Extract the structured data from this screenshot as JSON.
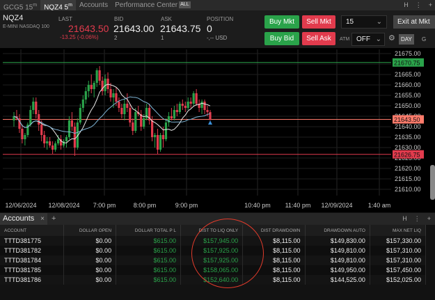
{
  "tabs": [
    {
      "label": "GCG5 15",
      "sup": "m"
    },
    {
      "label": "NQZ4 5",
      "sup": "m"
    },
    {
      "label": "Accounts",
      "sup": ""
    },
    {
      "label": "Performance Center",
      "sup": ""
    }
  ],
  "tabs_badge": "ALL",
  "quote": {
    "symbol": "NQZ4",
    "symbol_desc": "E-MINI NASDAQ 100",
    "last_label": "LAST",
    "last": "21643.50",
    "change": "-13.25 (-0.06%)",
    "bid_label": "BID",
    "bid": "21643.00",
    "bid_size": "2",
    "ask_label": "ASK",
    "ask": "21643.75",
    "ask_size": "1",
    "position_label": "POSITION",
    "position": "0",
    "position_sub": "-,-- USD"
  },
  "controls": {
    "buy_mkt": "Buy Mkt",
    "sell_mkt": "Sell Mkt",
    "buy_bid": "Buy Bid",
    "sell_ask": "Sell Ask",
    "qty": "15",
    "exit": "Exit at Mkt",
    "atm_label": "ATM",
    "atm_value": "OFF",
    "day": "DAY",
    "tif2": "G"
  },
  "chart_data": {
    "type": "candlestick",
    "y_ticks": [
      "21675.00",
      "21670.00",
      "21665.00",
      "21660.00",
      "21655.00",
      "21650.00",
      "21645.00",
      "21640.00",
      "21635.00",
      "21630.00",
      "21625.00",
      "21620.00",
      "21615.00",
      "21610.00"
    ],
    "ylim": [
      21607,
      21677
    ],
    "x_ticks": [
      "12/06/2024",
      "12/08/2024",
      "7:00 pm",
      "8:00 pm",
      "9:00 pm",
      "10:40 pm",
      "11:40 pm",
      "12/09/2024",
      "1:40 am"
    ],
    "price_labels": [
      {
        "value": 21670.75,
        "text": "21670.75",
        "color": "#2aa34a"
      },
      {
        "value": 21643.5,
        "text": "21643.50",
        "color": "#ff7b6b"
      },
      {
        "value": 21626.75,
        "text": "21626.75",
        "color": "#e23b4d"
      }
    ],
    "candles": [
      [
        21643,
        21647,
        21640,
        21645
      ],
      [
        21645,
        21648,
        21643,
        21644
      ],
      [
        21644,
        21646,
        21637,
        21639
      ],
      [
        21639,
        21641,
        21632,
        21634
      ],
      [
        21634,
        21637,
        21631,
        21636
      ],
      [
        21636,
        21642,
        21635,
        21641
      ],
      [
        21641,
        21650,
        21640,
        21648
      ],
      [
        21648,
        21654,
        21646,
        21652
      ],
      [
        21652,
        21654,
        21644,
        21646
      ],
      [
        21646,
        21648,
        21638,
        21641
      ],
      [
        21641,
        21643,
        21633,
        21636
      ],
      [
        21636,
        21638,
        21630,
        21632
      ],
      [
        21632,
        21635,
        21629,
        21633
      ],
      [
        21633,
        21635,
        21630,
        21631
      ],
      [
        21631,
        21633,
        21627,
        21629
      ],
      [
        21629,
        21633,
        21628,
        21632
      ],
      [
        21632,
        21636,
        21631,
        21634
      ],
      [
        21634,
        21636,
        21629,
        21631
      ],
      [
        21631,
        21634,
        21630,
        21633
      ],
      [
        21633,
        21636,
        21630,
        21635
      ],
      [
        21635,
        21645,
        21634,
        21643
      ],
      [
        21643,
        21647,
        21638,
        21640
      ],
      [
        21640,
        21642,
        21626,
        21630
      ],
      [
        21630,
        21644,
        21629,
        21642
      ],
      [
        21642,
        21651,
        21641,
        21649
      ],
      [
        21649,
        21655,
        21647,
        21653
      ],
      [
        21653,
        21659,
        21651,
        21657
      ],
      [
        21657,
        21662,
        21654,
        21660
      ],
      [
        21660,
        21665,
        21656,
        21658
      ],
      [
        21658,
        21662,
        21654,
        21661
      ],
      [
        21661,
        21668,
        21659,
        21667
      ],
      [
        21667,
        21669,
        21660,
        21662
      ],
      [
        21662,
        21664,
        21655,
        21657
      ],
      [
        21657,
        21665,
        21655,
        21663
      ],
      [
        21663,
        21666,
        21656,
        21658
      ],
      [
        21658,
        21661,
        21652,
        21654
      ],
      [
        21654,
        21658,
        21649,
        21656
      ],
      [
        21656,
        21659,
        21650,
        21652
      ],
      [
        21652,
        21654,
        21647,
        21649
      ],
      [
        21649,
        21651,
        21644,
        21646
      ],
      [
        21646,
        21653,
        21643,
        21651
      ],
      [
        21651,
        21656,
        21647,
        21649
      ],
      [
        21649,
        21651,
        21640,
        21642
      ],
      [
        21642,
        21644,
        21636,
        21638
      ],
      [
        21638,
        21649,
        21637,
        21647
      ],
      [
        21647,
        21650,
        21645,
        21646
      ],
      [
        21646,
        21648,
        21638,
        21640
      ],
      [
        21640,
        21646,
        21639,
        21644
      ],
      [
        21644,
        21651,
        21643,
        21649
      ],
      [
        21649,
        21651,
        21641,
        21643
      ],
      [
        21643,
        21645,
        21633,
        21635
      ],
      [
        21635,
        21637,
        21630,
        21636
      ],
      [
        21636,
        21639,
        21627,
        21629
      ],
      [
        21629,
        21637,
        21628,
        21636
      ],
      [
        21636,
        21640,
        21630,
        21634
      ],
      [
        21634,
        21644,
        21633,
        21642
      ],
      [
        21642,
        21647,
        21640,
        21645
      ],
      [
        21645,
        21649,
        21643,
        21644
      ],
      [
        21644,
        21650,
        21643,
        21648
      ],
      [
        21648,
        21651,
        21645,
        21647
      ],
      [
        21647,
        21652,
        21646,
        21651
      ],
      [
        21651,
        21653,
        21648,
        21650
      ],
      [
        21650,
        21652,
        21647,
        21649
      ],
      [
        21649,
        21654,
        21648,
        21652
      ],
      [
        21652,
        21654,
        21649,
        21651
      ],
      [
        21651,
        21657,
        21650,
        21656
      ],
      [
        21656,
        21658,
        21650,
        21651
      ],
      [
        21651,
        21653,
        21647,
        21649
      ],
      [
        21649,
        21653,
        21646,
        21652
      ],
      [
        21652,
        21653,
        21646,
        21648
      ],
      [
        21648,
        21650,
        21645,
        21647
      ],
      [
        21647,
        21648,
        21643,
        21643.5
      ]
    ]
  },
  "accounts": {
    "tab": "Accounts",
    "columns": [
      "ACCOUNT",
      "DOLLAR OPEN",
      "DOLLAR TOTAL P L",
      "DIST TO LIQ ONLY",
      "DIST DRAWDOWN",
      "DRAWDOWN AUTO",
      "MAX NET LIQ"
    ],
    "rows": [
      [
        "TTTD381775",
        "$0.00",
        "$615.00",
        "$157,945.00",
        "$8,115.00",
        "$149,830.00",
        "$157,330.00"
      ],
      [
        "TTTD381782",
        "$0.00",
        "$615.00",
        "$157,925.00",
        "$8,115.00",
        "$149,810.00",
        "$157,310.00"
      ],
      [
        "TTTD381784",
        "$0.00",
        "$615.00",
        "$157,925.00",
        "$8,115.00",
        "$149,810.00",
        "$157,310.00"
      ],
      [
        "TTTD381785",
        "$0.00",
        "$615.00",
        "$158,065.00",
        "$8,115.00",
        "$149,950.00",
        "$157,450.00"
      ],
      [
        "TTTD381786",
        "$0.00",
        "$615.00",
        "$152,640.00",
        "$8,115.00",
        "$144,525.00",
        "$152,025.00"
      ]
    ]
  }
}
